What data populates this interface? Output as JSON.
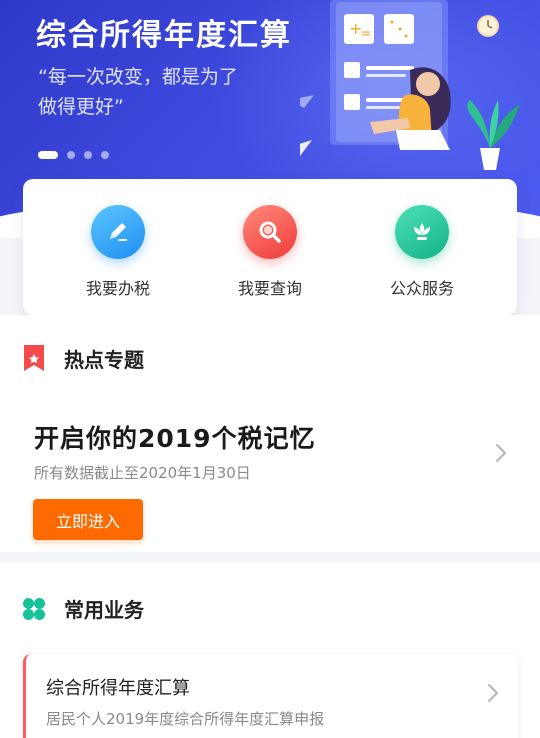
{
  "banner": {
    "title": "综合所得年度汇算",
    "quote_line1": "“每一次改变，都是为了",
    "quote_line2": "做得更好”",
    "slide_count": 4,
    "active_slide": 1
  },
  "actions": [
    {
      "label": "我要办税",
      "icon": "pen-edit-icon",
      "color": "#2aa3f2"
    },
    {
      "label": "我要查询",
      "icon": "search-icon",
      "color": "#f55353"
    },
    {
      "label": "公众服务",
      "icon": "flower-icon",
      "color": "#1fc29b"
    }
  ],
  "hot": {
    "section_title": "热点专题",
    "title": "开启你的2019个税记忆",
    "subtitle": "所有数据截止至2020年1月30日",
    "button": "立即进入",
    "icon": "bookmark-star-icon",
    "accent": "#ff6a00"
  },
  "common": {
    "section_title": "常用业务",
    "icon": "grid-clover-icon",
    "items": [
      {
        "title": "综合所得年度汇算",
        "desc": "居民个人2019年度综合所得年度汇算申报"
      }
    ]
  }
}
